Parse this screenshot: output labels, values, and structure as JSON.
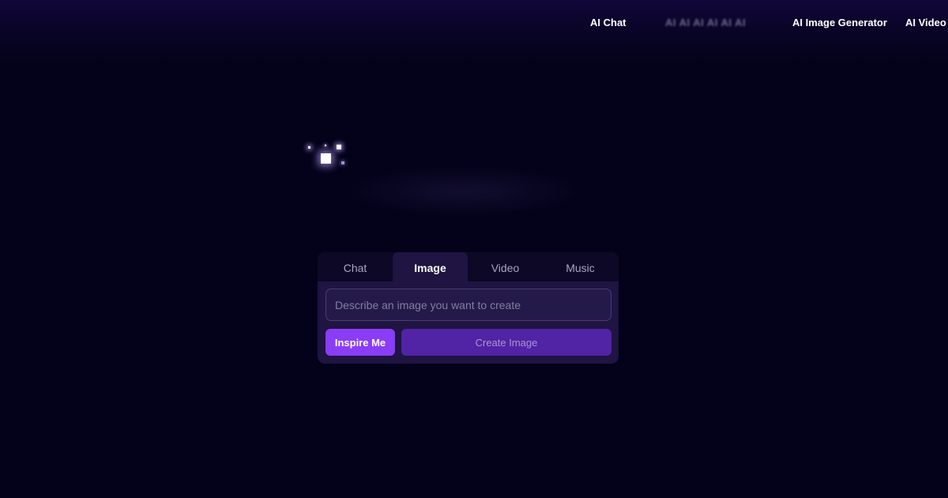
{
  "nav": {
    "items": [
      {
        "label": "AI Chat"
      },
      {
        "label": "AI AI AI AI AI AI"
      },
      {
        "label": "AI Image Generator"
      },
      {
        "label": "AI Video"
      }
    ]
  },
  "generator": {
    "tabs": [
      {
        "label": "Chat"
      },
      {
        "label": "Image"
      },
      {
        "label": "Video"
      },
      {
        "label": "Music"
      }
    ],
    "active_tab": "Image",
    "prompt": {
      "value": "",
      "placeholder": "Describe an image you want to create"
    },
    "inspire_label": "Inspire Me",
    "create_label": "Create Image"
  },
  "colors": {
    "background": "#03021a",
    "accent": "#8b3cf7",
    "create_button": "#5123a5",
    "panel": "#1f1442"
  }
}
